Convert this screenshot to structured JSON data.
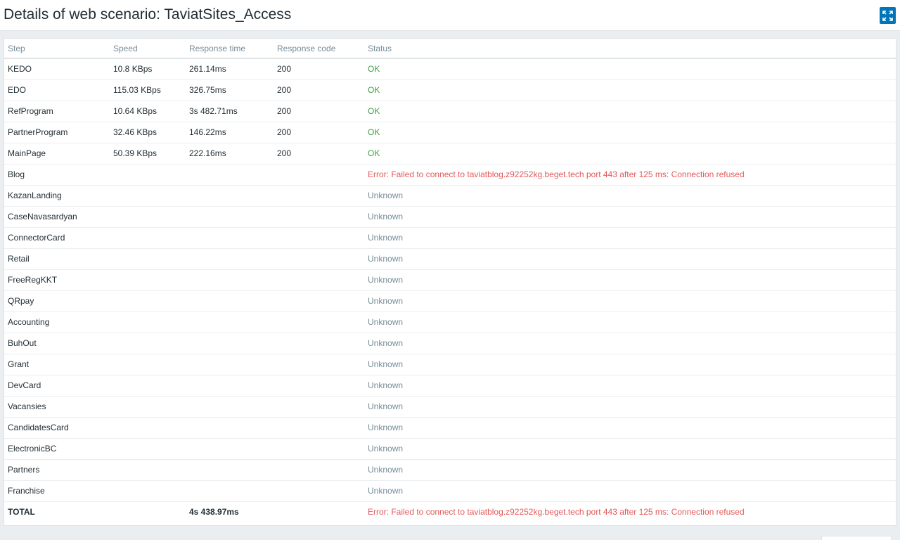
{
  "header": {
    "title": "Details of web scenario: TaviatSites_Access",
    "fullscreen_icon": "fullscreen-icon"
  },
  "colors": {
    "ok": "#429e47",
    "error": "#e45959",
    "unknown": "#768d99",
    "accent": "#0275b8"
  },
  "table": {
    "columns": [
      "Step",
      "Speed",
      "Response time",
      "Response code",
      "Status"
    ],
    "rows": [
      {
        "step": "KEDO",
        "speed": "10.8 KBps",
        "response_time": "261.14ms",
        "response_code": "200",
        "status": "OK",
        "status_type": "ok"
      },
      {
        "step": "EDO",
        "speed": "115.03 KBps",
        "response_time": "326.75ms",
        "response_code": "200",
        "status": "OK",
        "status_type": "ok"
      },
      {
        "step": "RefProgram",
        "speed": "10.64 KBps",
        "response_time": "3s 482.71ms",
        "response_code": "200",
        "status": "OK",
        "status_type": "ok"
      },
      {
        "step": "PartnerProgram",
        "speed": "32.46 KBps",
        "response_time": "146.22ms",
        "response_code": "200",
        "status": "OK",
        "status_type": "ok"
      },
      {
        "step": "MainPage",
        "speed": "50.39 KBps",
        "response_time": "222.16ms",
        "response_code": "200",
        "status": "OK",
        "status_type": "ok"
      },
      {
        "step": "Blog",
        "speed": "",
        "response_time": "",
        "response_code": "",
        "status": "Error: Failed to connect to taviatblog.z92252kg.beget.tech port 443 after 125 ms: Connection refused",
        "status_type": "error"
      },
      {
        "step": "KazanLanding",
        "speed": "",
        "response_time": "",
        "response_code": "",
        "status": "Unknown",
        "status_type": "unknown"
      },
      {
        "step": "CaseNavasardyan",
        "speed": "",
        "response_time": "",
        "response_code": "",
        "status": "Unknown",
        "status_type": "unknown"
      },
      {
        "step": "ConnectorCard",
        "speed": "",
        "response_time": "",
        "response_code": "",
        "status": "Unknown",
        "status_type": "unknown"
      },
      {
        "step": "Retail",
        "speed": "",
        "response_time": "",
        "response_code": "",
        "status": "Unknown",
        "status_type": "unknown"
      },
      {
        "step": "FreeRegKKT",
        "speed": "",
        "response_time": "",
        "response_code": "",
        "status": "Unknown",
        "status_type": "unknown"
      },
      {
        "step": "QRpay",
        "speed": "",
        "response_time": "",
        "response_code": "",
        "status": "Unknown",
        "status_type": "unknown"
      },
      {
        "step": "Accounting",
        "speed": "",
        "response_time": "",
        "response_code": "",
        "status": "Unknown",
        "status_type": "unknown"
      },
      {
        "step": "BuhOut",
        "speed": "",
        "response_time": "",
        "response_code": "",
        "status": "Unknown",
        "status_type": "unknown"
      },
      {
        "step": "Grant",
        "speed": "",
        "response_time": "",
        "response_code": "",
        "status": "Unknown",
        "status_type": "unknown"
      },
      {
        "step": "DevCard",
        "speed": "",
        "response_time": "",
        "response_code": "",
        "status": "Unknown",
        "status_type": "unknown"
      },
      {
        "step": "Vacansies",
        "speed": "",
        "response_time": "",
        "response_code": "",
        "status": "Unknown",
        "status_type": "unknown"
      },
      {
        "step": "CandidatesCard",
        "speed": "",
        "response_time": "",
        "response_code": "",
        "status": "Unknown",
        "status_type": "unknown"
      },
      {
        "step": "ElectronicBC",
        "speed": "",
        "response_time": "",
        "response_code": "",
        "status": "Unknown",
        "status_type": "unknown"
      },
      {
        "step": "Partners",
        "speed": "",
        "response_time": "",
        "response_code": "",
        "status": "Unknown",
        "status_type": "unknown"
      },
      {
        "step": "Franchise",
        "speed": "",
        "response_time": "",
        "response_code": "",
        "status": "Unknown",
        "status_type": "unknown"
      }
    ],
    "total": {
      "label": "TOTAL",
      "speed": "",
      "response_time": "4s 438.97ms",
      "response_code": "",
      "status": "Error: Failed to connect to taviatblog.z92252kg.beget.tech port 443 after 125 ms: Connection refused",
      "status_type": "error"
    }
  }
}
